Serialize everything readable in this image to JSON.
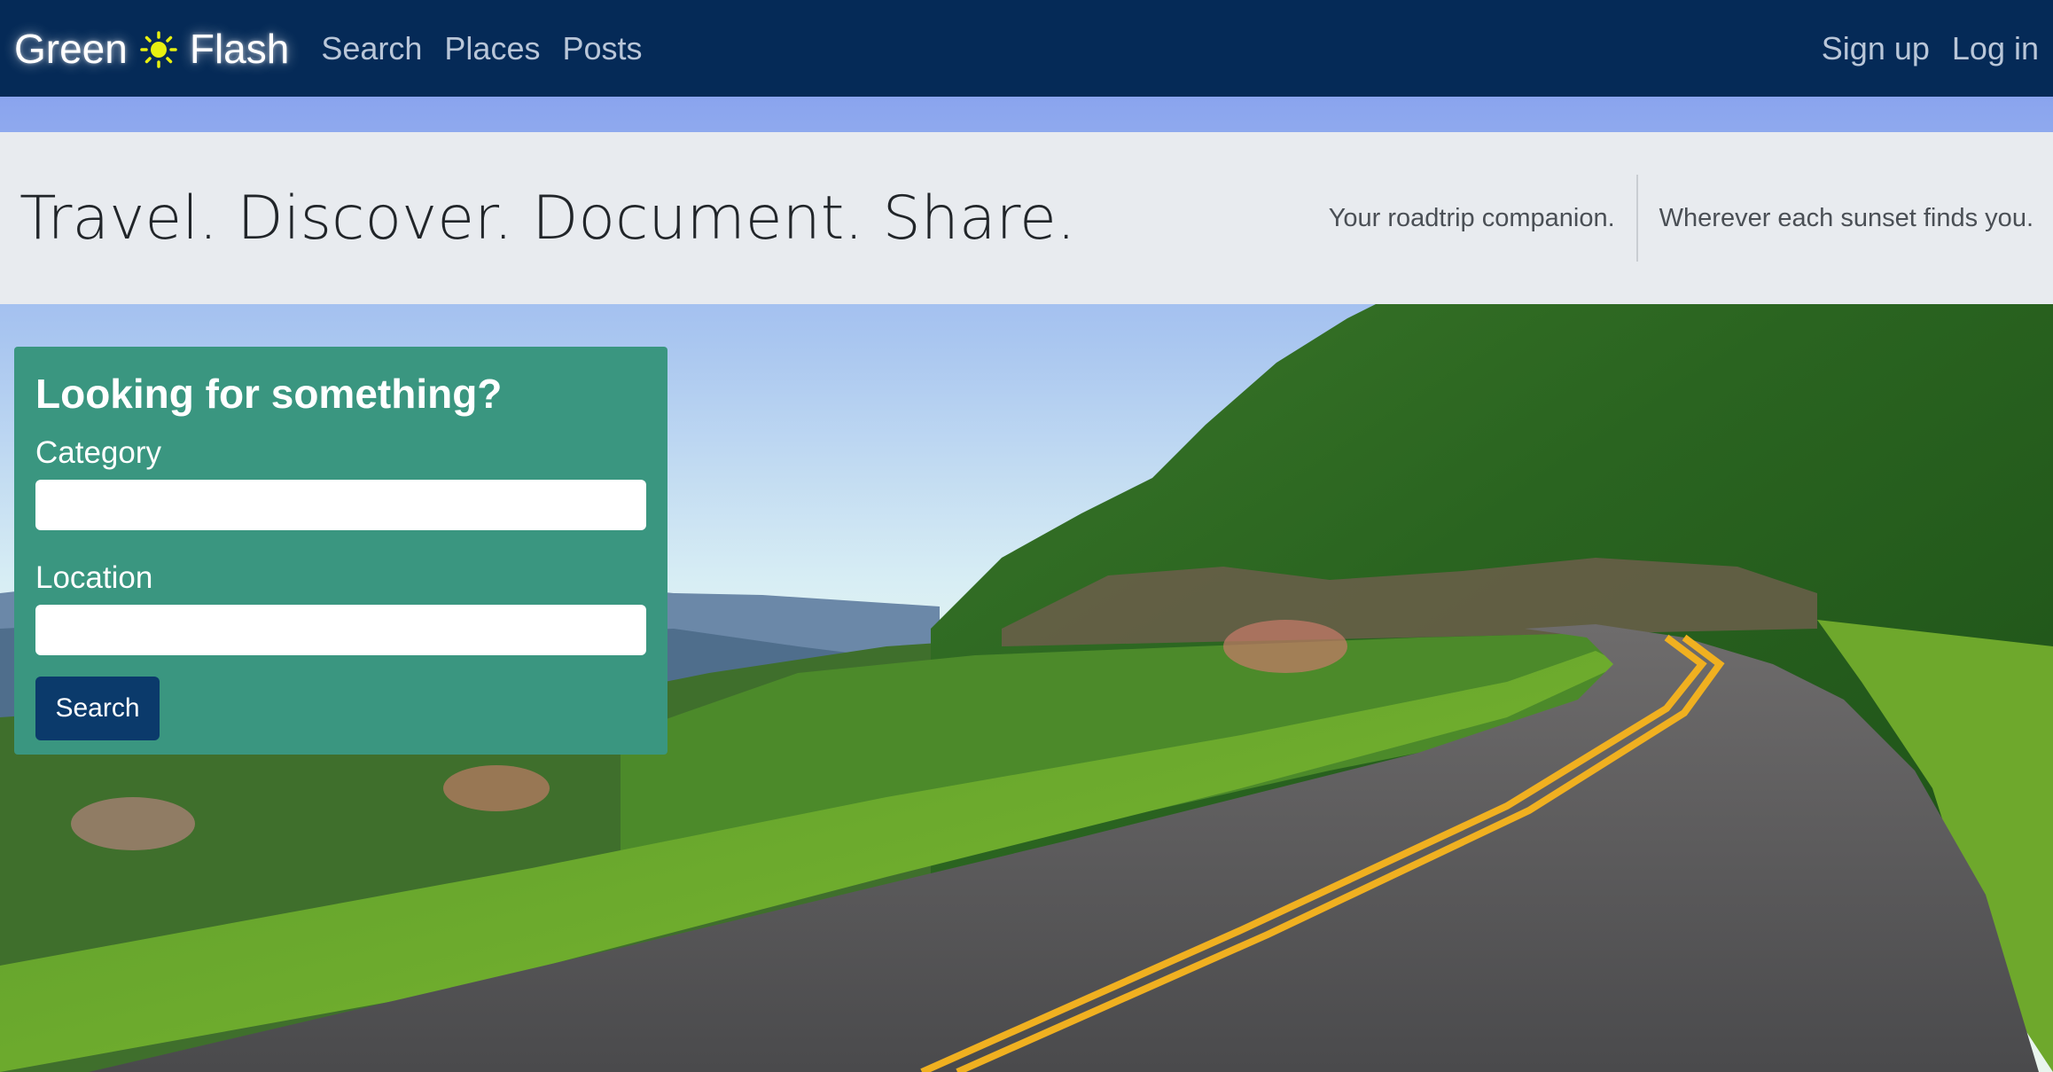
{
  "navbar": {
    "brand_left": "Green",
    "brand_icon": "sun-icon",
    "brand_right": "Flash",
    "links": [
      "Search",
      "Places",
      "Posts"
    ],
    "auth_links": [
      "Sign up",
      "Log in"
    ]
  },
  "hero": {
    "title": "Travel. Discover. Document. Share.",
    "tagline_1": "Your roadtrip companion.",
    "tagline_2": "Wherever each sunset finds you."
  },
  "search_card": {
    "heading": "Looking for something?",
    "category_label": "Category",
    "category_value": "",
    "location_label": "Location",
    "location_value": "",
    "button_label": "Search"
  },
  "colors": {
    "navbar": "#052a57",
    "card": "#3a9680",
    "button": "#0b3a6b",
    "hero": "#e8ebef",
    "sun": "#e8f010"
  }
}
